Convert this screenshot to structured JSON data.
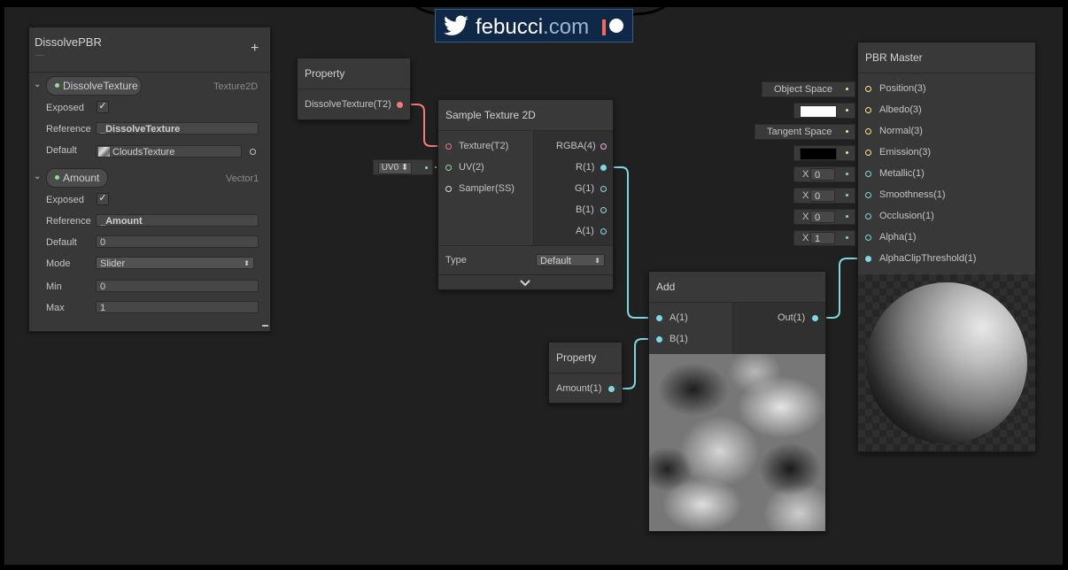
{
  "banner": {
    "brand": "febucci",
    "domain_suffix": ".com"
  },
  "blackboard": {
    "title": "DissolvePBR",
    "add_label": "+",
    "properties": [
      {
        "name": "DissolveTexture",
        "type": "Texture2D",
        "exposed_label": "Exposed",
        "exposed_check": "✓",
        "reference_label": "Reference",
        "reference_value": "_DissolveTexture",
        "default_label": "Default",
        "default_value": "CloudsTexture"
      },
      {
        "name": "Amount",
        "type": "Vector1",
        "exposed_label": "Exposed",
        "exposed_check": "✓",
        "reference_label": "Reference",
        "reference_value": "_Amount",
        "default_label": "Default",
        "default_value": "0",
        "mode_label": "Mode",
        "mode_value": "Slider",
        "min_label": "Min",
        "min_value": "0",
        "max_label": "Max",
        "max_value": "1"
      }
    ]
  },
  "property_node_texture": {
    "title": "Property",
    "output": "DissolveTexture(T2)"
  },
  "uv_inline": {
    "label": "UV0"
  },
  "sample_texture": {
    "title": "Sample Texture 2D",
    "inputs": [
      "Texture(T2)",
      "UV(2)",
      "Sampler(SS)"
    ],
    "outputs": [
      "RGBA(4)",
      "R(1)",
      "G(1)",
      "B(1)",
      "A(1)"
    ],
    "type_label": "Type",
    "type_value": "Default"
  },
  "add_node": {
    "title": "Add",
    "inputs": [
      "A(1)",
      "B(1)"
    ],
    "output": "Out(1)"
  },
  "property_node_amount": {
    "title": "Property",
    "output": "Amount(1)"
  },
  "master": {
    "title": "PBR Master",
    "inputs": [
      "Position(3)",
      "Albedo(3)",
      "Normal(3)",
      "Emission(3)",
      "Metallic(1)",
      "Smoothness(1)",
      "Occlusion(1)",
      "Alpha(1)",
      "AlphaClipThreshold(1)"
    ],
    "position_space": "Object Space",
    "normal_space": "Tangent Space",
    "albedo_color": "#ffffff",
    "emission_color": "#000000",
    "x_label": "X",
    "metallic_value": "0",
    "smoothness_value": "0",
    "occlusion_value": "0",
    "alpha_value": "1"
  },
  "colors": {
    "wire_texture": "#f27a7a",
    "wire_vector1": "#7fd8df",
    "wire_vector2": "#8fe08f",
    "wire_vector3": "#f2ea88",
    "twitter": "#1da1f2",
    "patreon": "#f96854",
    "banner_bg": "#0f2848"
  }
}
